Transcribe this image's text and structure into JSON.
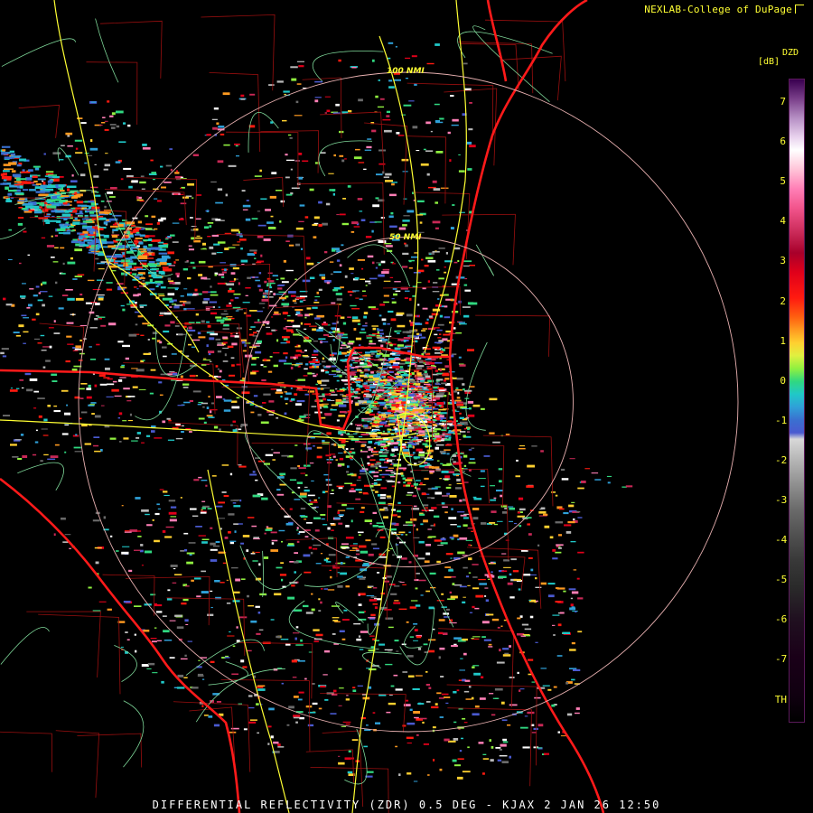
{
  "credit": "NEXLAB-College of DuPage",
  "legend": {
    "product_code": "DZD",
    "unit": "[dB]",
    "ticks": [
      "7",
      "6",
      "5",
      "4",
      "3",
      "2",
      "1",
      "0",
      "-1",
      "-2",
      "-3",
      "-4",
      "-5",
      "-6",
      "-7",
      "TH"
    ]
  },
  "rings": [
    {
      "label": "100 NMI",
      "range_nmi": 100
    },
    {
      "label": "50 NMI",
      "range_nmi": 50
    }
  ],
  "footer": "DIFFERENTIAL REFLECTIVITY (ZDR) 0.5 DEG - KJAX 2 JAN 26 12:50",
  "colors": {
    "state_borders": "#ff1a1a",
    "county_lines": "#a01010",
    "highways": "#ffff33",
    "roads": "#8fe0a0",
    "ring": "#e8b0b0",
    "text": "#ffff33"
  }
}
